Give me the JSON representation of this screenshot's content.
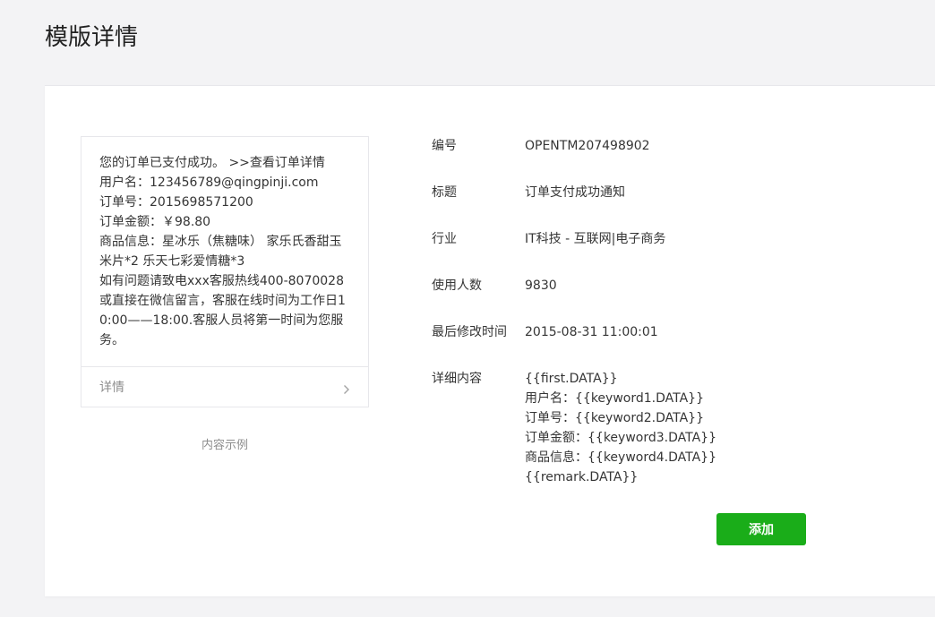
{
  "page": {
    "title": "模版详情"
  },
  "preview": {
    "lines": [
      "您的订单已支付成功。 >>查看订单详情",
      "用户名：123456789@qingpinji.com",
      "订单号：2015698571200",
      "订单金额：￥98.80",
      "商品信息：星冰乐（焦糖味） 家乐氏香甜玉米片*2 乐天七彩爱情糖*3",
      "如有问题请致电xxx客服热线400-8070028或直接在微信留言，客服在线时间为工作日10:00——18:00.客服人员将第一时间为您服务。"
    ],
    "footer_label": "详情",
    "caption": "内容示例"
  },
  "details": {
    "number": {
      "label": "编号",
      "value": "OPENTM207498902"
    },
    "title": {
      "label": "标题",
      "value": "订单支付成功通知"
    },
    "industry": {
      "label": "行业",
      "value": "IT科技 - 互联网|电子商务"
    },
    "users": {
      "label": "使用人数",
      "value": "9830"
    },
    "modified": {
      "label": "最后修改时间",
      "value": "2015-08-31 11:00:01"
    },
    "content": {
      "label": "详细内容",
      "lines": [
        "{{first.DATA}}",
        "用户名：{{keyword1.DATA}}",
        "订单号：{{keyword2.DATA}}",
        "订单金额：{{keyword3.DATA}}",
        "商品信息：{{keyword4.DATA}}",
        "{{remark.DATA}}"
      ]
    }
  },
  "actions": {
    "add_label": "添加"
  },
  "colors": {
    "accent": "#1aad19",
    "background": "#f3f3f5",
    "border": "#e7e7eb",
    "muted_text": "#8d8d8d"
  },
  "icons": {
    "footer_arrow": "chevron-right-icon"
  }
}
